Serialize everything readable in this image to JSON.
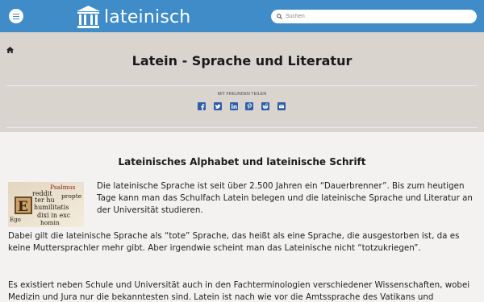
{
  "header": {
    "logo_text": "lateinisch",
    "search_placeholder": "Suchen",
    "brand_color": "#3f8cc9"
  },
  "hero": {
    "title": "Latein - Sprache und Literatur",
    "share_label": "MIT FREUNDEN TEILEN",
    "share_icons": [
      "facebook-icon",
      "twitter-icon",
      "linkedin-icon",
      "pinterest-icon",
      "reddit-icon",
      "email-icon"
    ]
  },
  "article": {
    "section_title": "Lateinisches Alphabet und lateinische Schrift",
    "thumb_words": [
      "Psalmus",
      "reddit",
      "propte",
      "ter hu",
      "humilitatis",
      "Ego",
      "dixi in exc",
      "homin"
    ],
    "paragraphs": [
      "Die lateinische Sprache ist seit über 2.500 Jahren ein “Dauerbrenner”. Bis zum heutigen Tage kann man das Schulfach Latein belegen und die lateinische Sprache und Literatur an der Universität studieren.",
      "Dabei gilt die lateinische Sprache als “tote” Sprache, das heißt als eine Sprache, die ausgestorben ist, da es keine Muttersprachler mehr gibt. Aber irgendwie scheint man das Lateinische nicht “totzukriegen”.",
      "Es existiert neben Schule und Universität auch in den Fachterminologien verschiedener Wissenschaften, wobei Medizin und Jura nur die bekanntesten sind. Latein ist nach wie vor die Amtssprache des Vatikans und"
    ]
  }
}
